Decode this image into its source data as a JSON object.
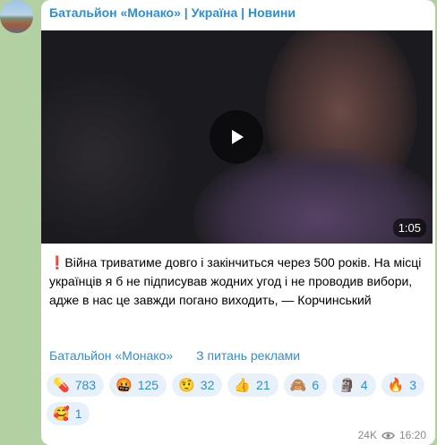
{
  "post": {
    "channel_title": "Батальйон «Монако» | Україна | Новини",
    "video": {
      "duration": "1:05"
    },
    "text": "❗️Війна триватиме довго і закінчиться через 500 років. На місці українців я б не підписував жодних угод і не проводив вибори, адже в нас це завжди погано виходить, — Корчинський",
    "links": [
      "Батальйон «Монако»",
      "З питань реклами"
    ],
    "reactions": [
      {
        "emoji": "💊",
        "count": "783"
      },
      {
        "emoji": "🤬",
        "count": "125"
      },
      {
        "emoji": "🤨",
        "count": "32"
      },
      {
        "emoji": "👍",
        "count": "21"
      },
      {
        "emoji": "🙈",
        "count": "6"
      },
      {
        "emoji": "🗿",
        "count": "4"
      },
      {
        "emoji": "🔥",
        "count": "3"
      },
      {
        "emoji": "🥰",
        "count": "1"
      }
    ],
    "views": "24K",
    "time": "16:20"
  }
}
